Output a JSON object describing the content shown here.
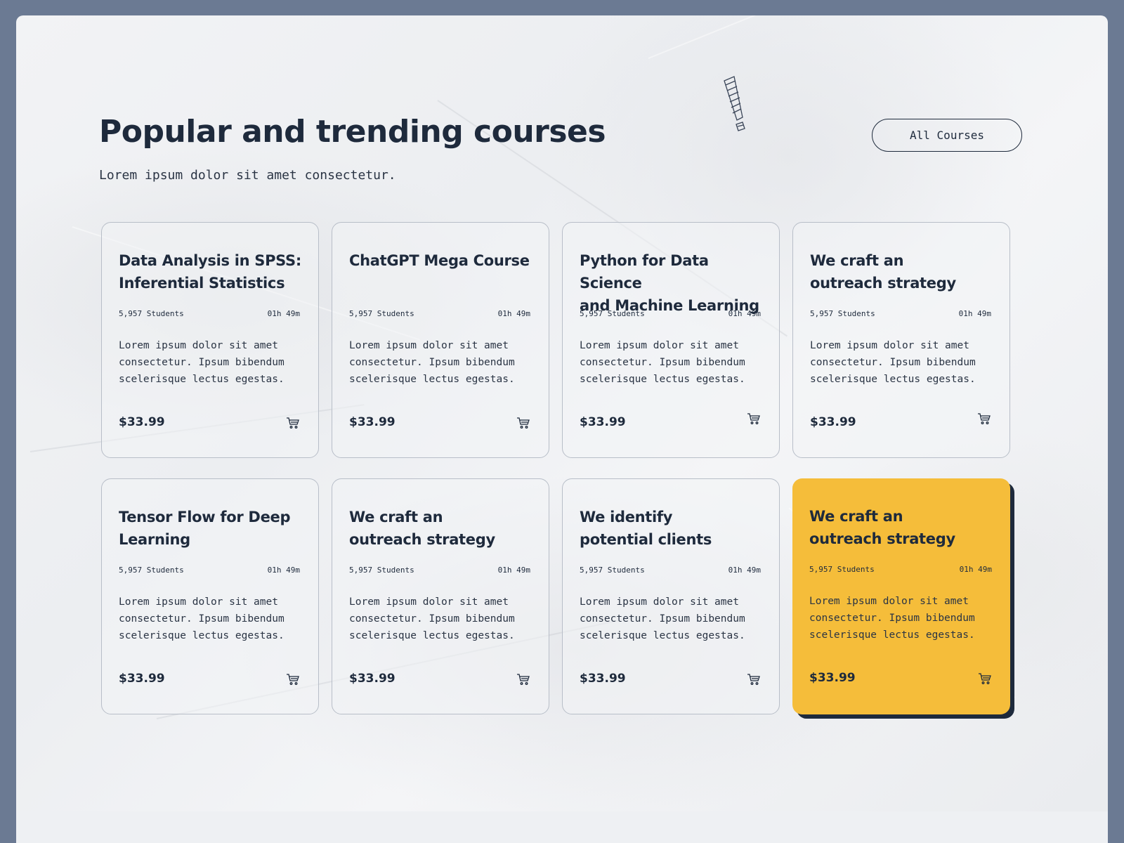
{
  "section": {
    "title": "Popular and trending courses",
    "subtitle": "Lorem ipsum dolor sit amet consectetur.",
    "all_courses_label": "All Courses"
  },
  "accent_color": "#f5bd3a",
  "text_color": "#1e2a3c",
  "courses": [
    {
      "title_line1": "Data Analysis in SPSS:",
      "title_line2": "Inferential Statistics",
      "students": "5,957 Students",
      "duration": "01h 49m",
      "description": "Lorem ipsum dolor sit amet consectetur. Ipsum bibendum scelerisque lectus egestas.",
      "price": "$33.99",
      "icon": "cart-icon"
    },
    {
      "title_line1": "ChatGPT Mega Course",
      "title_line2": "",
      "students": "5,957 Students",
      "duration": "01h 49m",
      "description": "Lorem ipsum dolor sit amet consectetur. Ipsum bibendum scelerisque lectus egestas.",
      "price": "$33.99",
      "icon": "cart-icon"
    },
    {
      "title_line1": "Python for Data Science",
      "title_line2": "and Machine Learning",
      "students": "5,957 Students",
      "duration": "01h 49m",
      "description": "Lorem ipsum dolor sit amet consectetur. Ipsum bibendum scelerisque lectus egestas.",
      "price": "$33.99",
      "icon": "cart-icon"
    },
    {
      "title_line1": "We craft an",
      "title_line2": "outreach strategy",
      "students": "5,957 Students",
      "duration": "01h 49m",
      "description": "Lorem ipsum dolor sit amet consectetur. Ipsum bibendum scelerisque lectus egestas.",
      "price": "$33.99",
      "icon": "cart-icon"
    },
    {
      "title_line1": "Tensor Flow for Deep",
      "title_line2": "Learning",
      "students": "5,957 Students",
      "duration": "01h 49m",
      "description": "Lorem ipsum dolor sit amet consectetur. Ipsum bibendum scelerisque lectus egestas.",
      "price": "$33.99",
      "icon": "cart-icon"
    },
    {
      "title_line1": "We craft an",
      "title_line2": "outreach strategy",
      "students": "5,957 Students",
      "duration": "01h 49m",
      "description": "Lorem ipsum dolor sit amet consectetur. Ipsum bibendum scelerisque lectus egestas.",
      "price": "$33.99",
      "icon": "cart-icon"
    },
    {
      "title_line1": "We identify",
      "title_line2": "potential clients",
      "students": "5,957 Students",
      "duration": "01h 49m",
      "description": "Lorem ipsum dolor sit amet consectetur. Ipsum bibendum scelerisque lectus egestas.",
      "price": "$33.99",
      "icon": "cart-icon"
    },
    {
      "title_line1": "We craft an",
      "title_line2": "outreach strategy",
      "students": "5,957 Students",
      "duration": "01h 49m",
      "description": "Lorem ipsum dolor sit amet consectetur. Ipsum bibendum scelerisque lectus egestas.",
      "price": "$33.99",
      "icon": "cart-icon",
      "featured": true
    }
  ]
}
